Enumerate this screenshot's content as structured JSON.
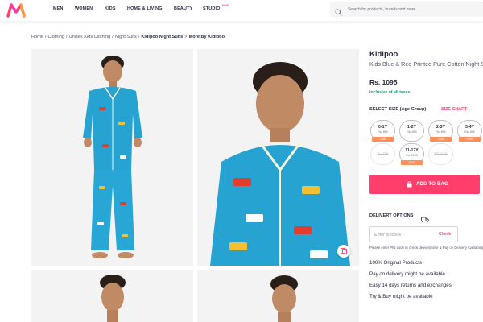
{
  "header": {
    "nav": [
      {
        "label": "MEN"
      },
      {
        "label": "WOMEN"
      },
      {
        "label": "KIDS"
      },
      {
        "label": "HOME & LIVING"
      },
      {
        "label": "BEAUTY"
      },
      {
        "label": "STUDIO"
      }
    ],
    "studio_badge": "NEW",
    "search_placeholder": "Search for products, brands and more",
    "brand_color": "#ff3f6c"
  },
  "breadcrumb": [
    {
      "label": "Home"
    },
    {
      "label": "Clothing"
    },
    {
      "label": "Unisex Kids Clothing"
    },
    {
      "label": "Night Suits"
    },
    {
      "label": "Kidipoo Night Suits"
    },
    {
      "label": "More By Kidipoo"
    }
  ],
  "gallery": {
    "images": [
      {
        "icon": "boy-full-length-pajama-photo"
      },
      {
        "icon": "boy-upper-body-pajama-photo"
      },
      {
        "icon": "boy-portrait-photo"
      },
      {
        "icon": "boy-portrait-photo"
      }
    ],
    "similar_icon": "similar-products-icon"
  },
  "product": {
    "brand": "Kidipoo",
    "title": "Kids Blue & Red Printed Pure Cotton Night Suit",
    "price": "Rs. 1095",
    "tax_note": "inclusive of all taxes",
    "select_size_label": "SELECT SIZE (Age Group)",
    "size_chart_label": "SIZE CHART ›",
    "sizes": [
      {
        "size": "0-1Y",
        "price": "Rs. 895",
        "left": "2 left",
        "available": true
      },
      {
        "size": "1-2Y",
        "price": "Rs. 895",
        "left": "",
        "available": true
      },
      {
        "size": "2-3Y",
        "price": "Rs. 895",
        "left": "3 left",
        "available": true
      },
      {
        "size": "3-4Y",
        "price": "Rs. 895",
        "left": "3 left",
        "available": true
      },
      {
        "size": "9-10Y",
        "price": "",
        "left": "",
        "available": false
      },
      {
        "size": "11-12Y",
        "price": "Rs. 1295",
        "left": "2 left",
        "available": true
      },
      {
        "size": "13-14Y",
        "price": "",
        "left": "",
        "available": false
      }
    ],
    "add_to_bag_label": "ADD TO BAG"
  },
  "delivery": {
    "title": "DELIVERY OPTIONS",
    "pincode_placeholder": "Enter pincode",
    "check_label": "Check",
    "note": "Please enter PIN code to check delivery time & Pay on Delivery Availability",
    "features": [
      {
        "text": "100% Original Products"
      },
      {
        "text": "Pay on delivery might be available"
      },
      {
        "text": "Easy 14 days returns and exchanges"
      },
      {
        "text": "Try & Buy might be available"
      }
    ]
  }
}
